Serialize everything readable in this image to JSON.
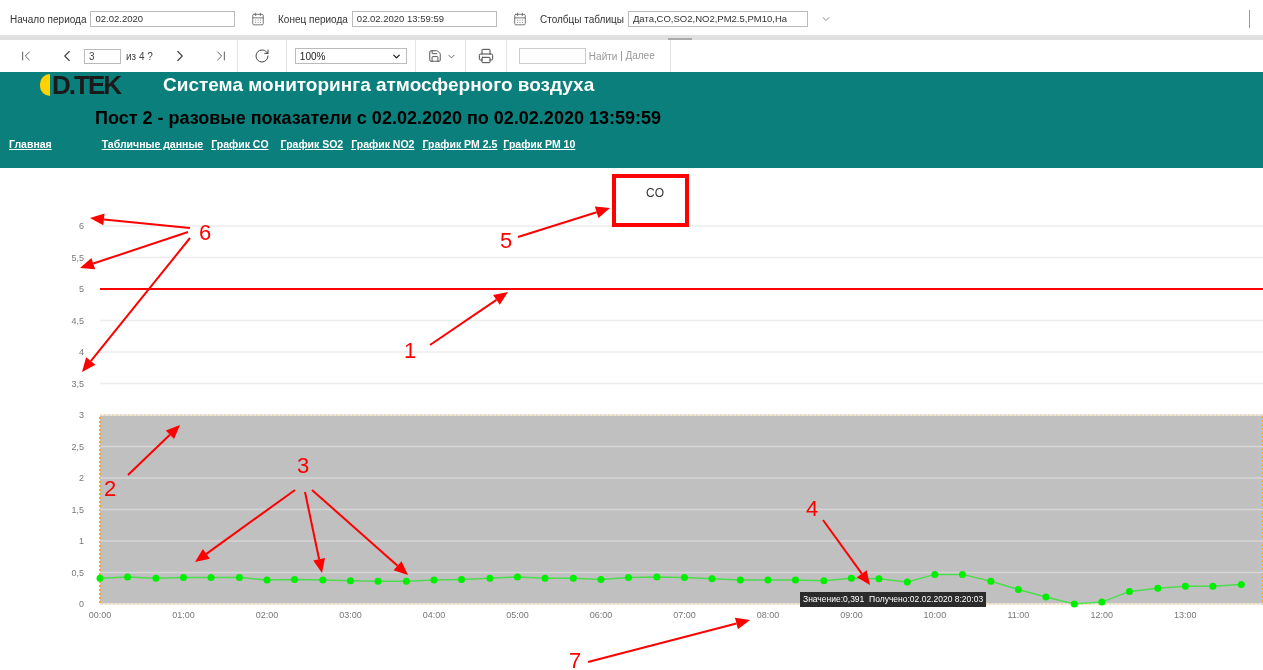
{
  "filters": [
    {
      "label": "Начало периода",
      "value": "02.02.2020",
      "kind": "date"
    },
    {
      "label": "Конец периода",
      "value": "02.02.2020 13:59:59",
      "kind": "date"
    },
    {
      "label": "Столбцы таблицы",
      "value": "Дата,CO,SO2,NO2,PM2.5,PM10,На",
      "kind": "dropdown"
    }
  ],
  "toolbar": {
    "page": "3",
    "page_count": "из 4 ?",
    "zoom": "100%",
    "find_button": "Найти",
    "next_button": "Далее"
  },
  "header": {
    "logo": "D.TEK",
    "title": "Система мониторинга атмосферного воздуха",
    "subtitle": "Пост 2 - разовые показатели с 02.02.2020 по 02.02.2020 13:59:59",
    "nav": [
      "Главная",
      "Табличные данные",
      "График CO",
      "График SO2",
      "График NO2",
      "График PM 2.5",
      "График PM 10"
    ]
  },
  "chart": {
    "tooltip": "Значение:0,391  Получено:02.02.2020 8:20:03",
    "chart_data": {
      "type": "line",
      "title": "CO",
      "x": [
        0,
        0.33,
        0.67,
        1,
        1.33,
        1.67,
        2,
        2.33,
        2.67,
        3,
        3.33,
        3.67,
        4,
        4.33,
        4.67,
        5,
        5.33,
        5.67,
        6,
        6.33,
        6.67,
        7,
        7.33,
        7.67,
        8,
        8.33,
        8.67,
        9,
        9.33,
        9.67,
        10,
        10.33,
        10.67,
        11,
        11.33,
        11.67,
        12,
        12.33,
        12.67,
        13,
        13.33,
        13.67
      ],
      "series": [
        {
          "color": "#00ee00",
          "values": [
            0.41,
            0.43,
            0.41,
            0.42,
            0.42,
            0.42,
            0.38,
            0.39,
            0.38,
            0.37,
            0.36,
            0.36,
            0.38,
            0.39,
            0.41,
            0.43,
            0.41,
            0.41,
            0.39,
            0.42,
            0.43,
            0.42,
            0.4,
            0.38,
            0.38,
            0.38,
            0.37,
            0.41,
            0.4,
            0.35,
            0.47,
            0.47,
            0.36,
            0.23,
            0.11,
            0,
            0.03,
            0.2,
            0.25,
            0.28,
            0.28,
            0.31
          ]
        }
      ],
      "xlim": [
        0,
        13.93
      ],
      "ylim": [
        0,
        6
      ],
      "xticks": [
        {
          "value": 0,
          "label": "00:00"
        },
        {
          "value": 1,
          "label": "01:00"
        },
        {
          "value": 2,
          "label": "02:00"
        },
        {
          "value": 3,
          "label": "03:00"
        },
        {
          "value": 4,
          "label": "04:00"
        },
        {
          "value": 5,
          "label": "05:00"
        },
        {
          "value": 6,
          "label": "06:00"
        },
        {
          "value": 7,
          "label": "07:00"
        },
        {
          "value": 8,
          "label": "08:00"
        },
        {
          "value": 9,
          "label": "09:00"
        },
        {
          "value": 10,
          "label": "10:00"
        },
        {
          "value": 11,
          "label": "11:00"
        },
        {
          "value": 12,
          "label": "12:00"
        },
        {
          "value": 13,
          "label": "13:00"
        }
      ],
      "yticks": [
        {
          "value": 0,
          "label": "0"
        },
        {
          "value": 0.5,
          "label": "0,5"
        },
        {
          "value": 1,
          "label": "1"
        },
        {
          "value": 1.5,
          "label": "1,5"
        },
        {
          "value": 2,
          "label": "2"
        },
        {
          "value": 2.5,
          "label": "2,5"
        },
        {
          "value": 3,
          "label": "3"
        },
        {
          "value": 3.5,
          "label": "3,5"
        },
        {
          "value": 4,
          "label": "4"
        },
        {
          "value": 4.5,
          "label": "4,5"
        },
        {
          "value": 5,
          "label": "5"
        },
        {
          "value": 5.5,
          "label": "5,5"
        },
        {
          "value": 6,
          "label": "6"
        }
      ],
      "grid": true,
      "marker": "circle",
      "ref_lines": [
        {
          "axis": "y",
          "value": 5,
          "color": "#ff0000"
        }
      ],
      "bands": [
        {
          "axis": "y",
          "from": 0,
          "to": 3,
          "color": "#c0c0c0"
        }
      ]
    }
  },
  "callouts": [
    {
      "label": "1"
    },
    {
      "label": "2"
    },
    {
      "label": "3"
    },
    {
      "label": "4"
    },
    {
      "label": "5"
    },
    {
      "label": "6"
    },
    {
      "label": "7"
    }
  ]
}
